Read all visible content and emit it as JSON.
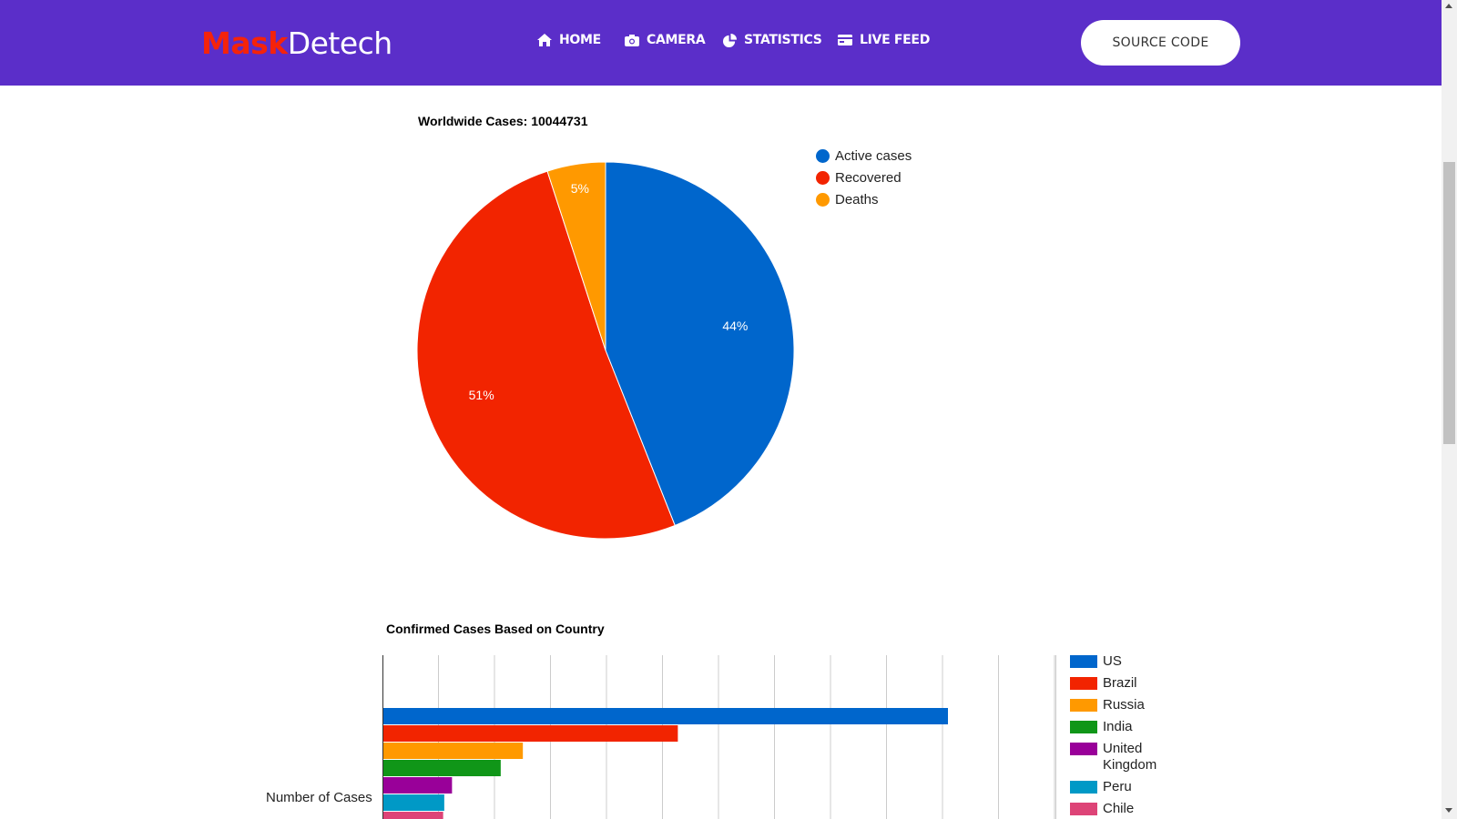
{
  "navbar": {
    "logo_part1": "Mask",
    "logo_part2": "Detech",
    "items": [
      {
        "label": "HOME",
        "icon": "home-icon"
      },
      {
        "label": "CAMERA",
        "icon": "camera-icon"
      },
      {
        "label": "STATISTICS",
        "icon": "pie-chart-icon"
      },
      {
        "label": "LIVE FEED",
        "icon": "card-icon"
      }
    ],
    "source_button": "SOURCE CODE",
    "bg_color": "#5b2ec9"
  },
  "chart_data": [
    {
      "type": "pie",
      "title": "Worldwide Cases: 10044731",
      "slices": [
        {
          "label": "Active cases",
          "value": 44,
          "display": "44%",
          "color": "#0066cc"
        },
        {
          "label": "Recovered",
          "value": 51,
          "display": "51%",
          "color": "#f22400"
        },
        {
          "label": "Deaths",
          "value": 5,
          "display": "5%",
          "color": "#ff9900"
        }
      ],
      "legend_position": "right"
    },
    {
      "type": "bar",
      "orientation": "horizontal",
      "title": "Confirmed Cases Based on Country",
      "ylabel": "Number of Cases",
      "categories": [
        "US",
        "Brazil",
        "Russia",
        "India",
        "United Kingdom",
        "Peru",
        "Chile"
      ],
      "values": [
        2550000,
        1330000,
        630000,
        530000,
        310000,
        275000,
        270000
      ],
      "colors": [
        "#0066cc",
        "#f22400",
        "#ff9900",
        "#109618",
        "#990099",
        "#0099c6",
        "#dd4477"
      ],
      "xlim": [
        0,
        3000000
      ],
      "grid": true,
      "legend_position": "right"
    }
  ]
}
